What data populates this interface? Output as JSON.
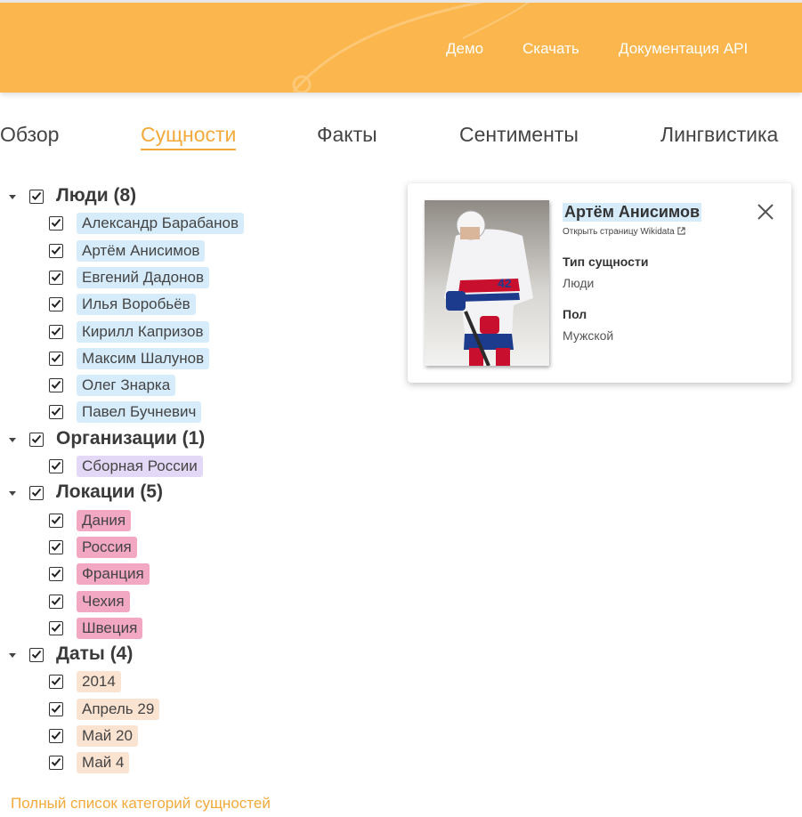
{
  "header": {
    "nav": [
      "Демо",
      "Скачать",
      "Документация API"
    ]
  },
  "tabs": [
    "Обзор",
    "Сущности",
    "Факты",
    "Сентименты",
    "Лингвистика"
  ],
  "active_tab": "Сущности",
  "entities": {
    "categories": [
      {
        "label": "Люди (8)",
        "type": "person",
        "items": [
          "Александр Барабанов",
          "Артём Анисимов",
          "Евгений Дадонов",
          "Илья Воробьёв",
          "Кирилл Капризов",
          "Максим Шалунов",
          "Олег Знарка",
          "Павел Бучневич"
        ]
      },
      {
        "label": "Организации (1)",
        "type": "org",
        "items": [
          "Сборная России"
        ]
      },
      {
        "label": "Локации (5)",
        "type": "loc",
        "items": [
          "Дания",
          "Россия",
          "Франция",
          "Чехия",
          "Швеция"
        ]
      },
      {
        "label": "Даты (4)",
        "type": "date",
        "items": [
          "2014",
          "Апрель 29",
          "Май 20",
          "Май 4"
        ]
      }
    ],
    "full_list_link": "Полный список категорий сущностей"
  },
  "card": {
    "name": "Артём Анисимов",
    "wikidata_link": "Открыть страницу Wikidata",
    "props": [
      {
        "label": "Тип сущности",
        "value": "Люди"
      },
      {
        "label": "Пол",
        "value": "Мужской"
      }
    ]
  },
  "colors": {
    "header_bg": "#fbb64d",
    "accent": "#f4a93b",
    "person_chip": "#d6ecfb",
    "org_chip": "#e3d8f6",
    "loc_chip": "#f2a7c2",
    "date_chip": "#fbe3d2"
  }
}
